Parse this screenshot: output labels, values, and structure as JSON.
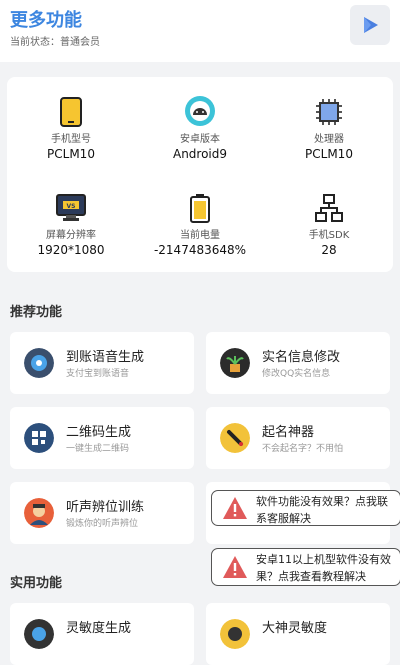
{
  "header": {
    "title": "更多功能",
    "status": "当前状态：普通会员"
  },
  "device_info": [
    {
      "label": "手机型号",
      "value": "PCLM10",
      "icon": "phone-icon"
    },
    {
      "label": "安卓版本",
      "value": "Android9",
      "icon": "android-icon"
    },
    {
      "label": "处理器",
      "value": "PCLM10",
      "icon": "cpu-chip-icon"
    },
    {
      "label": "屏幕分辨率",
      "value": "1920*1080",
      "icon": "monitor-icon"
    },
    {
      "label": "当前电量",
      "value": "-2147483648%",
      "icon": "battery-icon"
    },
    {
      "label": "手机SDK",
      "value": "28",
      "icon": "network-nodes-icon"
    }
  ],
  "sections": {
    "recommended": "推荐功能",
    "practical": "实用功能"
  },
  "recommended": [
    {
      "name": "到账语音生成",
      "desc": "支付宝到账语音"
    },
    {
      "name": "实名信息修改",
      "desc": "修改QQ实名信息"
    },
    {
      "name": "二维码生成",
      "desc": "一键生成二维码"
    },
    {
      "name": "起名神器",
      "desc": "不会起名字？不用怕"
    },
    {
      "name": "听声辨位训练",
      "desc": "锻炼你的听声辨位"
    }
  ],
  "practical": [
    {
      "name": "灵敏度生成"
    },
    {
      "name": "大神灵敏度"
    }
  ],
  "toasts": [
    "软件功能没有效果？点我联系客服解决",
    "安卓11以上机型软件没有效果？点我查看教程解决"
  ],
  "colors": {
    "accent": "#3d86e0",
    "warning": "#e05a5a"
  }
}
